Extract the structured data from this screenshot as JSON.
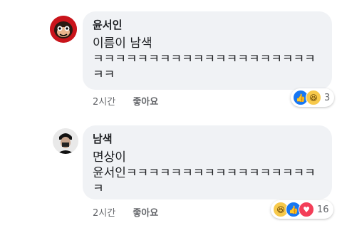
{
  "comments": [
    {
      "author": "윤서인",
      "lines": [
        "이름이 남색",
        "ㅋㅋㅋㅋㅋㅋㅋㅋㅋㅋㅋㅋㅋㅋㅋㅋㅋㅋㅋㅋ",
        "ㅋㅋ"
      ],
      "time": "2시간",
      "like_label": "좋아요",
      "reactions": {
        "icons": [
          "like-icon",
          "haha-icon"
        ],
        "count": "3"
      }
    },
    {
      "author": "남색",
      "lines": [
        "면상이",
        "윤서인ㅋㅋㅋㅋㅋㅋㅋㅋㅋㅋㅋㅋㅋㅋㅋㅋㅋ",
        "ㅋ"
      ],
      "time": "2시간",
      "like_label": "좋아요",
      "reactions": {
        "icons": [
          "haha-icon",
          "like-icon",
          "love-icon"
        ],
        "count": "16"
      }
    }
  ],
  "colors": {
    "bubble": "#f0f2f5",
    "like": "#1877f2",
    "haha": "#f7c94b",
    "love": "#f33e58",
    "meta": "#65676b"
  }
}
